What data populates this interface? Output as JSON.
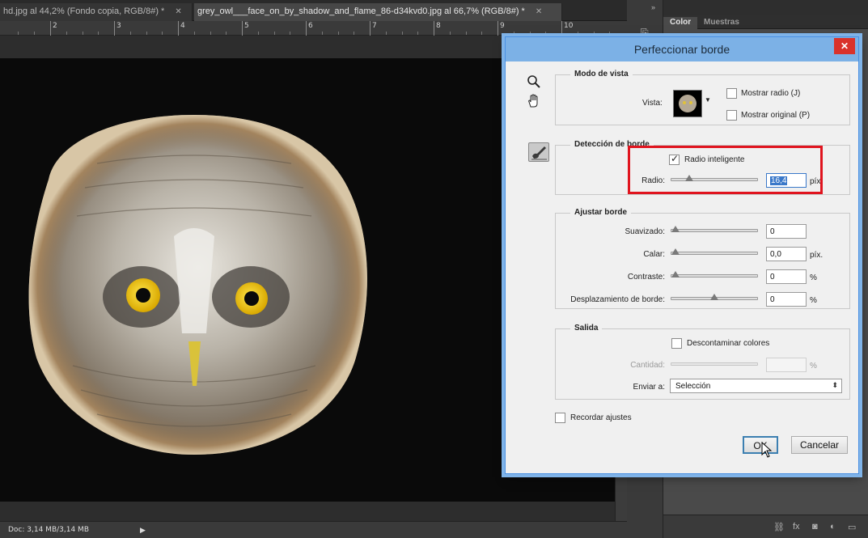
{
  "document_tabs": [
    {
      "label": "hd.jpg al 44,2% (Fondo copia, RGB/8#) *",
      "active": false
    },
    {
      "label": "grey_owl___face_on_by_shadow_and_flame_86-d34kvd0.jpg al 66,7% (RGB/8#) *",
      "active": true
    }
  ],
  "ruler": {
    "numbers": [
      "2",
      "3",
      "4",
      "5",
      "6",
      "7",
      "8",
      "9",
      "10"
    ]
  },
  "status": {
    "doc_size": "Doc: 3,14 MB/3,14 MB"
  },
  "right_panel": {
    "tabs": [
      "Color",
      "Muestras"
    ],
    "collapse_arrows": "»"
  },
  "dialog": {
    "title": "Perfeccionar borde",
    "close": "✕",
    "tools": [
      "zoom-icon",
      "hand-icon",
      "refine-radius-brush-icon"
    ],
    "view_mode": {
      "title": "Modo de vista",
      "vista_label": "Vista:",
      "show_radius": {
        "label": "Mostrar radio (J)",
        "checked": false
      },
      "show_original": {
        "label": "Mostrar original (P)",
        "checked": false
      }
    },
    "edge_detection": {
      "title": "Detección de borde",
      "smart_radius": {
        "label": "Radio inteligente",
        "checked": true
      },
      "radius_label": "Radio:",
      "radius_value": "16,4",
      "radius_unit": "píx.",
      "radius_position": 0.18
    },
    "adjust_edge": {
      "title": "Ajustar borde",
      "rows": [
        {
          "label": "Suavizado:",
          "value": "0",
          "unit": "",
          "position": 0.0
        },
        {
          "label": "Calar:",
          "value": "0,0",
          "unit": "píx.",
          "position": 0.0
        },
        {
          "label": "Contraste:",
          "value": "0",
          "unit": "%",
          "position": 0.0
        },
        {
          "label": "Desplazamiento de borde:",
          "value": "0",
          "unit": "%",
          "position": 0.5
        }
      ]
    },
    "output": {
      "title": "Salida",
      "decontaminate": {
        "label": "Descontaminar colores",
        "checked": false
      },
      "amount_label": "Cantidad:",
      "amount_value": "",
      "amount_unit": "%",
      "send_to_label": "Enviar a:",
      "send_to_value": "Selección"
    },
    "remember": {
      "label": "Recordar ajustes",
      "checked": false
    },
    "ok_label": "OK",
    "cancel_label": "Cancelar"
  },
  "colors": {
    "dialog_title_bar": "#7cb1e6",
    "highlight": "#e0141e",
    "close_button": "#d9322b"
  }
}
